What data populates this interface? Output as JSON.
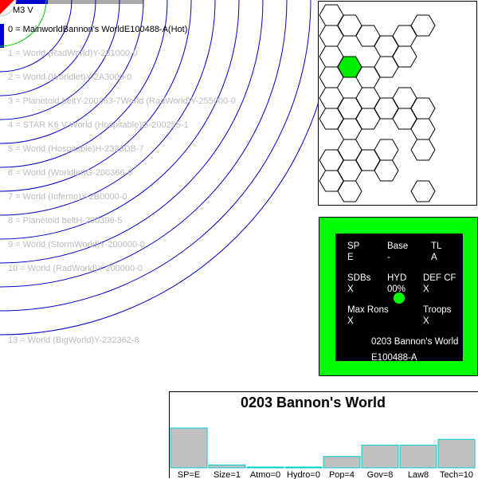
{
  "system": {
    "star_label": "M3 V",
    "orbits": [
      {
        "label": "0 = MainworldBannon's WorldE100488-A(Hot)",
        "main": true
      },
      {
        "label": "1 = World  (RadWorld)Y-231000-0"
      },
      {
        "label": "2 = World  (Worldlet)Y-2A3000-0"
      },
      {
        "label": "3 = Planetoid beltY-200363-7World  (RadWorld)Y-255000-0"
      },
      {
        "label": "4 = STAR K6 V World  (Hospitable)G-200255-1"
      },
      {
        "label": "5 = World  (Hospitable)H-2323DB-7"
      },
      {
        "label": "6 = World  (Worldlet)G-200366-9"
      },
      {
        "label": "7 = World  (Inferno)Y-2B0000-0"
      },
      {
        "label": "8 = Planetoid beltH-200396-5"
      },
      {
        "label": "9 = World  (StormWorld)Y-200000-0"
      },
      {
        "label": "10 = World  (RadWorld)Y-200000-0"
      },
      {
        "label": "13 = World  (BigWorld)Y-232362-8"
      }
    ],
    "colors": {
      "orbit": "#0000cc",
      "star_corner": "#ff0000",
      "habitable": "#00cc00"
    }
  },
  "hexmap": {
    "highlight_color": "#00ee00",
    "hexes": [
      [
        0,
        0
      ],
      [
        1,
        0
      ],
      [
        5,
        0
      ],
      [
        0,
        1
      ],
      [
        2,
        1
      ],
      [
        3,
        1
      ],
      [
        4,
        1
      ],
      [
        0,
        2
      ],
      [
        1,
        2
      ],
      [
        3,
        2
      ],
      [
        4,
        2
      ],
      [
        0,
        3
      ],
      [
        2,
        3
      ],
      [
        0,
        4
      ],
      [
        1,
        4
      ],
      [
        2,
        4
      ],
      [
        3,
        4
      ],
      [
        4,
        4
      ],
      [
        5,
        4
      ],
      [
        0,
        5
      ],
      [
        1,
        5
      ],
      [
        2,
        5
      ],
      [
        4,
        5
      ],
      [
        5,
        5
      ],
      [
        1,
        6
      ],
      [
        3,
        6
      ],
      [
        5,
        6
      ],
      [
        0,
        7
      ],
      [
        1,
        7
      ],
      [
        2,
        7
      ],
      [
        3,
        7
      ],
      [
        0,
        8
      ],
      [
        1,
        8
      ],
      [
        5,
        8
      ]
    ],
    "highlight": [
      1,
      2
    ]
  },
  "world": {
    "sp_label": "SP",
    "sp_value": "E",
    "base_label": "Base",
    "base_value": "-",
    "tl_label": "TL",
    "tl_value": "A",
    "sdbs_label": "SDBs",
    "sdbs_value": "X",
    "hyd_label": "HYD",
    "hyd_value": "00%",
    "defcf_label": "DEF CF",
    "defcf_value": "X",
    "maxrons_label": "Max Rons",
    "maxrons_value": "X",
    "troops_label": "Troops",
    "troops_value": "X",
    "name": "0203 Bannon's World",
    "uwp": "E100488-A"
  },
  "bars": {
    "title": "0203 Bannon's World",
    "chart_data": {
      "type": "bar",
      "categories": [
        "SP=E",
        "Size=1",
        "Atmo=0",
        "Hydro=0",
        "Pop=4",
        "Gov=8",
        "Law8",
        "Tech=10"
      ],
      "values": [
        14,
        1,
        0,
        0,
        4,
        8,
        8,
        10
      ],
      "ylim": [
        0,
        14
      ],
      "bar_color": "#c0c0c0",
      "bar_edge": "#00cccc"
    }
  }
}
